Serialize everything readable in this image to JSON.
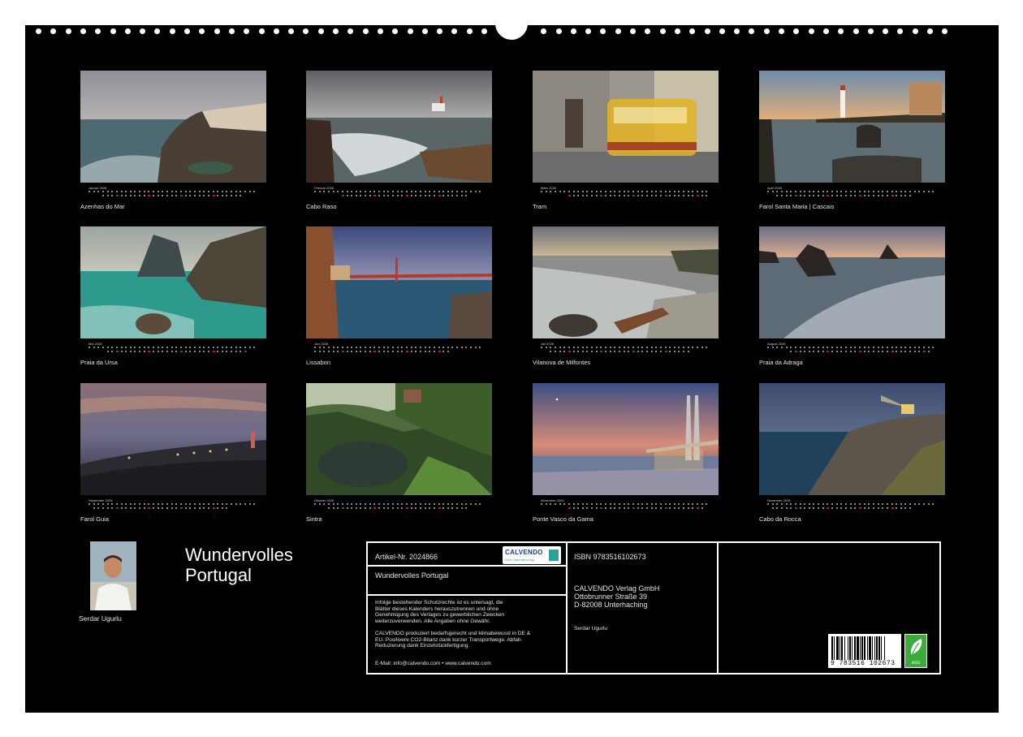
{
  "months": [
    {
      "label": "Januar 2026",
      "caption": "Azenhas do Mar",
      "offset": 3,
      "days": 31,
      "sundays": [
        4,
        11,
        18,
        25
      ]
    },
    {
      "label": "Februar 2026",
      "caption": "Cabo Raso",
      "offset": 6,
      "days": 28,
      "sundays": [
        1,
        8,
        15,
        22
      ]
    },
    {
      "label": "März 2026",
      "caption": "Tram",
      "offset": 6,
      "days": 31,
      "sundays": [
        1,
        8,
        15,
        22,
        29
      ]
    },
    {
      "label": "April 2026",
      "caption": "Farol Santa Maria | Cascais",
      "offset": 2,
      "days": 30,
      "sundays": [
        5,
        12,
        19,
        26
      ]
    },
    {
      "label": "Mai 2026",
      "caption": "Praia da Ursa",
      "offset": 4,
      "days": 31,
      "sundays": [
        3,
        10,
        17,
        24,
        31
      ]
    },
    {
      "label": "Juni 2026",
      "caption": "Lissabon",
      "offset": 0,
      "days": 30,
      "sundays": [
        7,
        14,
        21,
        28
      ]
    },
    {
      "label": "Juli 2026",
      "caption": "Vilanova de Milfontes",
      "offset": 2,
      "days": 31,
      "sundays": [
        5,
        12,
        19,
        26
      ]
    },
    {
      "label": "August 2026",
      "caption": "Praia da Adraga",
      "offset": 5,
      "days": 31,
      "sundays": [
        2,
        9,
        16,
        23,
        30
      ]
    },
    {
      "label": "September 2026",
      "caption": "Farol Guia",
      "offset": 1,
      "days": 30,
      "sundays": [
        6,
        13,
        20,
        27
      ]
    },
    {
      "label": "Oktober 2026",
      "caption": "Sintra",
      "offset": 3,
      "days": 31,
      "sundays": [
        4,
        11,
        18,
        25
      ]
    },
    {
      "label": "November 2026",
      "caption": "Ponte Vasco da Gama",
      "offset": 6,
      "days": 30,
      "sundays": [
        1,
        8,
        15,
        22,
        29
      ]
    },
    {
      "label": "Dezember 2026",
      "caption": "Cabo da Rocca",
      "offset": 1,
      "days": 31,
      "sundays": [
        6,
        13,
        20,
        27
      ]
    }
  ],
  "cover": {
    "title_line1": "Wundervolles",
    "title_line2": "Portugal",
    "author": "Serdar Ugurlu"
  },
  "info": {
    "article_no": "Artikel-Nr. 2024866",
    "logo_text": "CALVENDO",
    "logo_sub": "Dein Kalenderverlag",
    "product_title": "Wundervolles Portugal",
    "legal_text": "Infolge bestehender Schutzrechte ist es untersagt, die\nBlätter dieses Kalenders herauszutrennen und ohne\nGenehmigung des Verlages zu gewerblichen Zwecken\nweiterzuverwenden. Alle Angaben ohne Gewähr.",
    "eco_text": "CALVENDO produziert bedarfsgerecht und klimabewusst in DE &\nEU. Positivere CO2-Bilanz dank kurzer Transportwege. Abfall-\nReduzierung dank Einzelstückfertigung.",
    "email_line": "E-Mail: info@calvendo.com • www.calvendo.com",
    "isbn": "ISBN 9783516102673",
    "publisher_name": "CALVENDO Verlag GmbH",
    "publisher_street": "Ottobrunner Straße 39",
    "publisher_city": "D-82008 Unterhaching",
    "photographer": "Serdar Ugurlu",
    "barcode_number": "9 783516 102673",
    "eco_badge": "eco"
  },
  "colors": {
    "background": "#000000",
    "text": "#e6e6e6",
    "sunday_mark": "#9c2a2a"
  }
}
